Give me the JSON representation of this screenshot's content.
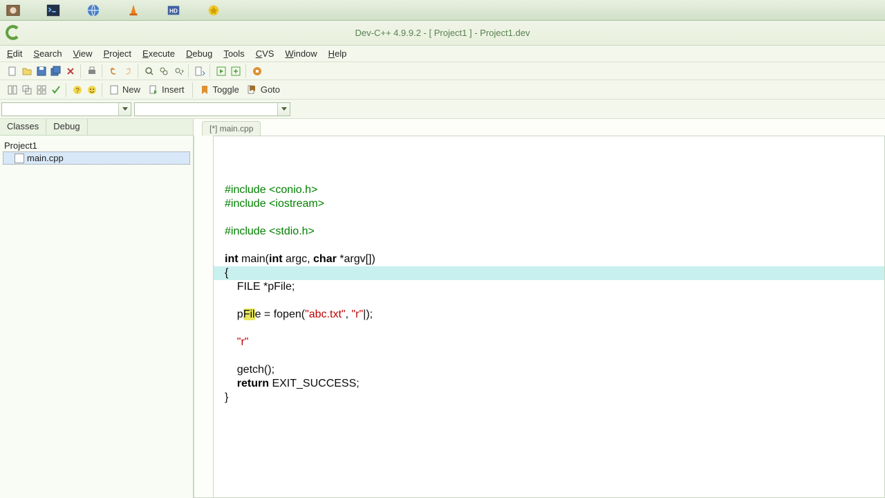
{
  "app_title": "Dev-C++ 4.9.9.2 - [ Project1 ] - Project1.dev",
  "menus": [
    "Edit",
    "Search",
    "View",
    "Project",
    "Execute",
    "Debug",
    "Tools",
    "CVS",
    "Window",
    "Help"
  ],
  "toolbar2": {
    "new": "New",
    "insert": "Insert",
    "toggle": "Toggle",
    "goto": "Goto"
  },
  "side_tabs": {
    "classes": "Classes",
    "debug": "Debug"
  },
  "tree": {
    "root": "Project1",
    "file": "main.cpp"
  },
  "file_tab": "[*] main.cpp",
  "code": {
    "l1a": "#include <conio.h>",
    "l2a": "#include <iostream>",
    "l3a": "#include <stdio.h>",
    "l5_int": "int",
    "l5_mid": " main(",
    "l5_int2": "int",
    "l5_argc": " argc, ",
    "l5_char": "char",
    "l5_rest": " *argv[])",
    "l6": "{",
    "l7": "    FILE *pFile;",
    "l9_pre": "    p",
    "l9_hi": "Fil",
    "l9_post": "e = fopen(",
    "l9_s1": "\"abc.txt\"",
    "l9_comma": ", ",
    "l9_s2": "\"r\"",
    "l9_end": "|);",
    "l11_pad": "    ",
    "l11_str": "\"r\"",
    "l13": "    getch();",
    "l14_pad": "    ",
    "l14_ret": "return",
    "l14_rest": " EXIT_SUCCESS;",
    "l15": "}"
  }
}
